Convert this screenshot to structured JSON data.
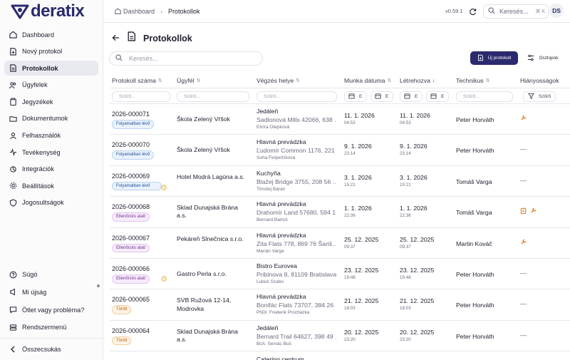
{
  "app": {
    "logo_text": "deratix",
    "version": "v0.59.1",
    "search_label": "Keresés...",
    "search_kbd": "⌘ K",
    "avatar": "DS",
    "accent": "#2b2a6e"
  },
  "breadcrumb": {
    "home": "Dashboard",
    "current": "Protokollok"
  },
  "sidebar": {
    "items": [
      {
        "label": "Dashboard",
        "icon": "home-icon"
      },
      {
        "label": "Nový protokol",
        "icon": "file-plus-icon"
      },
      {
        "label": "Protokollok",
        "icon": "document-icon",
        "active": true
      },
      {
        "label": "Ügyfelek",
        "icon": "users-icon"
      },
      {
        "label": "Jegyzékek",
        "icon": "clipboard-icon"
      },
      {
        "label": "Dokumentumok",
        "icon": "folder-icon"
      },
      {
        "label": "Felhasználók",
        "icon": "user-icon"
      },
      {
        "label": "Tevékenység",
        "icon": "activity-icon"
      },
      {
        "label": "Integrációk",
        "icon": "plug-icon"
      },
      {
        "label": "Beállítások",
        "icon": "gear-icon"
      },
      {
        "label": "Jogosultságok",
        "icon": "shield-icon"
      }
    ],
    "bottom": [
      {
        "label": "Súgó",
        "icon": "help-icon"
      },
      {
        "label": "Mi újság",
        "icon": "news-icon"
      },
      {
        "label": "Ötlet vagy probléma?",
        "icon": "chat-icon"
      },
      {
        "label": "Rendszermenü",
        "icon": "server-icon"
      }
    ],
    "collapse": "Összecsukás"
  },
  "page": {
    "title": "Protokollok",
    "search_placeholder": "Keresés...",
    "new_button": "Új protokoll",
    "columns_button": "Oszlopok"
  },
  "table": {
    "columns": [
      "Protokoll száma",
      "Ügyfél",
      "Végzés helye",
      "Munka dátuma",
      "Létrehozva",
      "Technikus",
      "Hiányosságok"
    ],
    "filter_placeholder": "Szűrő...",
    "date_filter": "E",
    "issues_filter": "Szűrő",
    "rows": [
      {
        "number": "2026-000071",
        "status": "Folyamatban lévő",
        "status_type": "prog",
        "clock": false,
        "client": "Škola Zelený Vŕšok",
        "loc_name": "Jedáleň",
        "loc_addr": "Sadlonová Mills 42066, 638 …",
        "loc_person": "Elvíra Otepková",
        "work_date": "11. 1. 2026",
        "work_time": "04:53",
        "created_date": "11. 1. 2026",
        "created_time": "04:53",
        "tech": "Peter Horváth",
        "issues": [
          "wrench-icon"
        ]
      },
      {
        "number": "2026-000070",
        "status": "Folyamatban lévő",
        "status_type": "prog",
        "clock": false,
        "client": "Škola Zelený Vŕšok",
        "loc_name": "Hlavná prevádzka",
        "loc_addr": "Ľudomír Common 1176, 221 …",
        "loc_person": "Soňa Ferjenčíková",
        "work_date": "9. 1. 2026",
        "work_time": "23:14",
        "created_date": "9. 1. 2026",
        "created_time": "23:14",
        "tech": "Peter Horváth",
        "issues": []
      },
      {
        "number": "2026-000069",
        "status": "Folyamatban lévő",
        "status_type": "prog",
        "clock": true,
        "client": "Hotel Modrá Lagúna a.s.",
        "loc_name": "Kuchyňa",
        "loc_addr": "Blažej Bridge 3755, 208 56 …",
        "loc_person": "Timotej Baran",
        "work_date": "3. 1. 2026",
        "work_time": "15:21",
        "created_date": "3. 1. 2026",
        "created_time": "15:21",
        "tech": "Tomáš Varga",
        "issues": []
      },
      {
        "number": "2026-000068",
        "status": "Ellenőrzés alatt",
        "status_type": "check",
        "clock": false,
        "client": "Sklad Dunajská Brána a.s.",
        "loc_name": "Hlavná prevádzka",
        "loc_addr": "Drahomír Land 57680, 594 1…",
        "loc_person": "Bernard Bartoš",
        "work_date": "1. 1. 2026",
        "work_time": "22:36",
        "created_date": "1. 1. 2026",
        "created_time": "22:36",
        "tech": "Tomáš Varga",
        "issues": [
          "clipboard-icon",
          "wrench-icon"
        ]
      },
      {
        "number": "2026-000067",
        "status": "Ellenőrzés alatt",
        "status_type": "check",
        "clock": false,
        "client": "Pekáreň Slnečnica s.r.o.",
        "loc_name": "Hlavná prevádzka",
        "loc_addr": "Zita Flats 778, 869 76 Šariš…",
        "loc_person": "Marián Varga",
        "work_date": "25. 12. 2025",
        "work_time": "09:37",
        "created_date": "25. 12. 2025",
        "created_time": "09:37",
        "tech": "Martin Kováč",
        "issues": [
          "wrench-icon"
        ]
      },
      {
        "number": "2026-000066",
        "status": "Ellenőrzés alatt",
        "status_type": "check",
        "clock": true,
        "client": "Gastro Perla s.r.o.",
        "loc_name": "Bistro Eurovea",
        "loc_addr": "Pribinova 8, 81109 Bratislava",
        "loc_person": "Ľuboš Szabo",
        "work_date": "23. 12. 2025",
        "work_time": "19:48",
        "created_date": "23. 12. 2025",
        "created_time": "19:48",
        "tech": "Peter Horváth",
        "issues": []
      },
      {
        "number": "2026-000065",
        "status": "Törölt",
        "status_type": "draft",
        "clock": false,
        "client": "SVB Ružová 12-14, Modrovka",
        "loc_name": "Hlavná prevádzka",
        "loc_addr": "Bonifác Flats 73707, 384 26 …",
        "loc_person": "PhDr. Frederik Procházka",
        "work_date": "21. 12. 2025",
        "work_time": "18:03",
        "created_date": "21. 12. 2025",
        "created_time": "18:03",
        "tech": "Peter Horváth",
        "issues": []
      },
      {
        "number": "2026-000064",
        "status": "Törölt",
        "status_type": "draft",
        "clock": false,
        "client": "Sklad Dunajská Brána a.s.",
        "loc_name": "Jedáleň",
        "loc_addr": "Bernard Trail 64627, 398 49 …",
        "loc_person": "BcA. Servác Buš",
        "work_date": "20. 12. 2025",
        "work_time": "23:20",
        "created_date": "20. 12. 2025",
        "created_time": "23:20",
        "tech": "Peter Horváth",
        "issues": []
      }
    ],
    "partial_next": "Catering centrum"
  }
}
